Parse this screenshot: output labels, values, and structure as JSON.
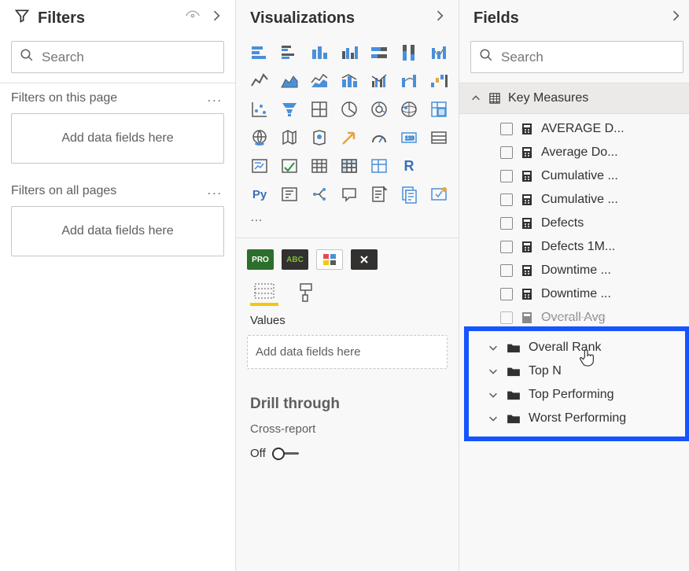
{
  "filters": {
    "title": "Filters",
    "search_placeholder": "Search",
    "page_label": "Filters on this page",
    "page_dropzone": "Add data fields here",
    "all_label": "Filters on all pages",
    "all_dropzone": "Add data fields here"
  },
  "viz": {
    "title": "Visualizations",
    "more": "…",
    "values_tab": "Values",
    "values_dropzone": "Add data fields here",
    "drill_title": "Drill through",
    "cross_report": "Cross-report",
    "toggle_off": "Off",
    "r_label": "R",
    "py_label": "Py"
  },
  "fields": {
    "title": "Fields",
    "search_placeholder": "Search",
    "group": "Key Measures",
    "measures": [
      "AVERAGE D...",
      "Average Do...",
      "Cumulative ...",
      "Cumulative ...",
      "Defects",
      "Defects 1M...",
      "Downtime ...",
      "Downtime ...",
      "Overall Avg"
    ],
    "folders": [
      "Overall Rank",
      "Top N",
      "Top Performing",
      "Worst Performing"
    ]
  }
}
